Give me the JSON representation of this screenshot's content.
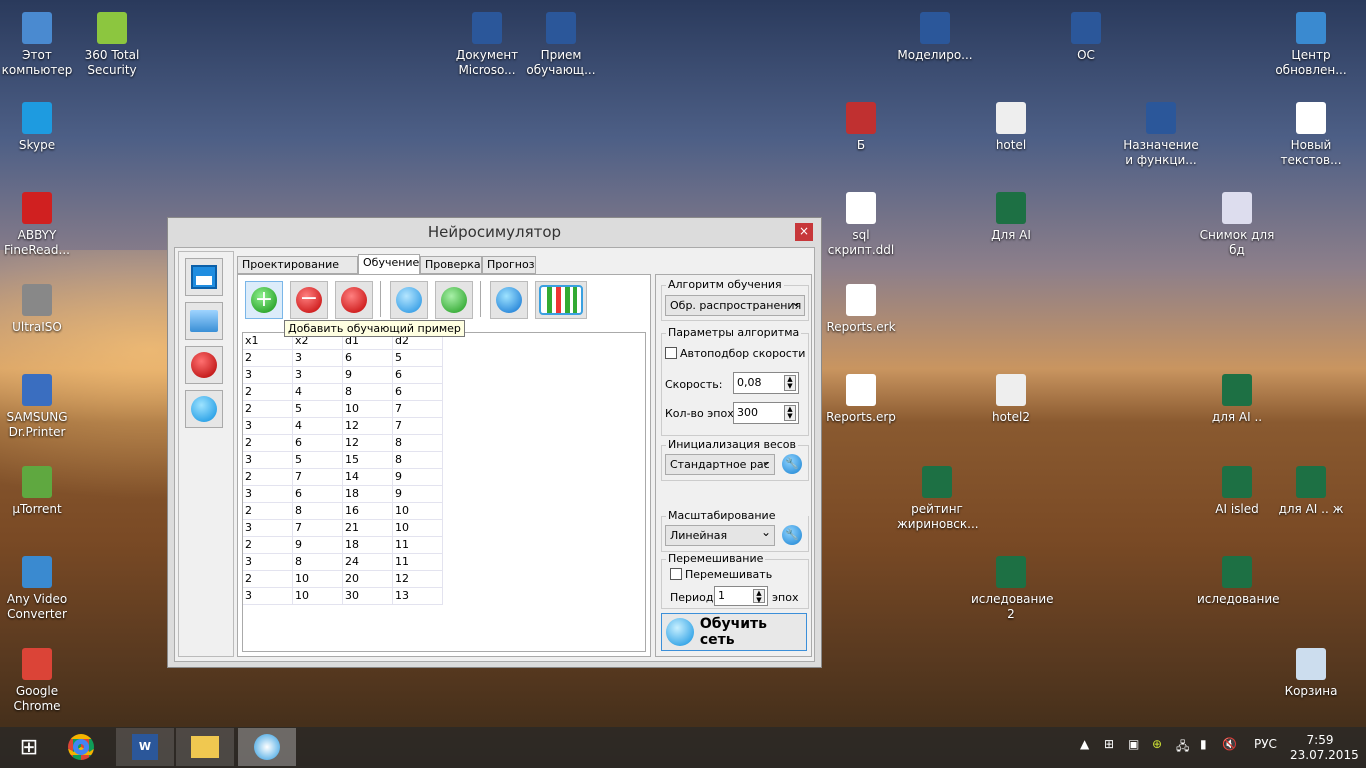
{
  "desktop": {
    "icons": [
      "Этот компьютер",
      "360 Total Security",
      "Skype",
      "ABBYY FineRead...",
      "UltraISO",
      "SAMSUNG Dr.Printer",
      "µTorrent",
      "Any Video Converter",
      "Google Chrome",
      "Документ Microso...",
      "Прием обучающ...",
      "Моделиро...",
      "ОС",
      "Центр обновлен...",
      "Б",
      "hotel",
      "Назначение и функци...",
      "Новый текстов...",
      "sql скрипт.ddl",
      "Для AI",
      "Снимок для бд",
      "Reports.erk",
      "Reports.erp",
      "hotel2",
      "для AI ..",
      "рейтинг жириновск...",
      "AI isled",
      "для AI .. ж",
      "иследование 2",
      "иследование",
      "Корзина"
    ]
  },
  "window": {
    "title": "Нейросимулятор",
    "close": "×",
    "tabs": [
      "Проектирование сети",
      "Обучение",
      "Проверка",
      "Прогноз"
    ],
    "active_tab": "Обучение",
    "tooltip": "Добавить обучающий пример",
    "table": {
      "headers": [
        "x1",
        "x2",
        "d1",
        "d2"
      ],
      "rows": [
        [
          "2",
          "3",
          "6",
          "5"
        ],
        [
          "3",
          "3",
          "9",
          "6"
        ],
        [
          "2",
          "4",
          "8",
          "6"
        ],
        [
          "2",
          "5",
          "10",
          "7"
        ],
        [
          "3",
          "4",
          "12",
          "7"
        ],
        [
          "2",
          "6",
          "12",
          "8"
        ],
        [
          "3",
          "5",
          "15",
          "8"
        ],
        [
          "2",
          "7",
          "14",
          "9"
        ],
        [
          "3",
          "6",
          "18",
          "9"
        ],
        [
          "2",
          "8",
          "16",
          "10"
        ],
        [
          "3",
          "7",
          "21",
          "10"
        ],
        [
          "2",
          "9",
          "18",
          "11"
        ],
        [
          "3",
          "8",
          "24",
          "11"
        ],
        [
          "2",
          "10",
          "20",
          "12"
        ],
        [
          "3",
          "10",
          "30",
          "13"
        ]
      ]
    },
    "right": {
      "algo_legend": "Алгоритм обучения",
      "algo_value": "Обр. распространения",
      "params_legend": "Параметры алгоритма",
      "auto_speed": "Автоподбор скорости",
      "auto_speed_checked": false,
      "speed_label": "Скорость:",
      "speed_value": "0,08",
      "epochs_label": "Кол-во эпох:",
      "epochs_value": "300",
      "init_legend": "Инициализация весов",
      "init_value": "Стандартное рас",
      "scale_legend": "Масштабирование данных",
      "scale_value": "Линейная",
      "shuffle_legend": "Перемешивание",
      "shuffle_label": "Перемешивать",
      "shuffle_checked": false,
      "period_label": "Период:",
      "period_value": "1",
      "period_unit": "эпох",
      "train_button": "Обучить сеть"
    }
  },
  "taskbar": {
    "lang": "РУС",
    "time": "7:59",
    "date": "23.07.2015"
  }
}
